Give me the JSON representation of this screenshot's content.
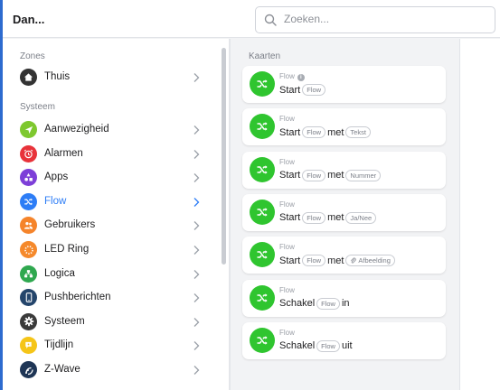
{
  "header": {
    "title": "Dan...",
    "search_placeholder": "Zoeken..."
  },
  "sidebar": {
    "zones_label": "Zones",
    "systeem_label": "Systeem",
    "zones": [
      {
        "label": "Thuis",
        "icon": "home-icon",
        "color": "#333333"
      }
    ],
    "items": [
      {
        "label": "Aanwezigheid",
        "icon": "location-arrow-icon",
        "color": "#7ec82f"
      },
      {
        "label": "Alarmen",
        "icon": "alarm-clock-icon",
        "color": "#e8333a"
      },
      {
        "label": "Apps",
        "icon": "apps-shapes-icon",
        "color": "#7d3fd8"
      },
      {
        "label": "Flow",
        "icon": "flow-shuffle-icon",
        "color": "#2d7df6",
        "active": true
      },
      {
        "label": "Gebruikers",
        "icon": "users-icon",
        "color": "#f5842b"
      },
      {
        "label": "LED Ring",
        "icon": "led-ring-icon",
        "color": "#f5892b"
      },
      {
        "label": "Logica",
        "icon": "logic-blocks-icon",
        "color": "#2fa84f"
      },
      {
        "label": "Pushberichten",
        "icon": "phone-icon",
        "color": "#24456b"
      },
      {
        "label": "Systeem",
        "icon": "gear-icon",
        "color": "#3a3a3a"
      },
      {
        "label": "Tijdlijn",
        "icon": "timeline-icon",
        "color": "#f5c518"
      },
      {
        "label": "Z-Wave",
        "icon": "zwave-icon",
        "color": "#1e3555"
      }
    ]
  },
  "main": {
    "kaarten_label": "Kaarten",
    "cards": [
      {
        "kind": "Flow",
        "has_info": true,
        "verb": "Start",
        "tag": "Flow",
        "extra_word": "",
        "extra_tag": "",
        "extra_icon": ""
      },
      {
        "kind": "Flow",
        "verb": "Start",
        "tag": "Flow",
        "extra_word": "met",
        "extra_tag": "Tekst",
        "extra_icon": ""
      },
      {
        "kind": "Flow",
        "verb": "Start",
        "tag": "Flow",
        "extra_word": "met",
        "extra_tag": "Nummer",
        "extra_icon": ""
      },
      {
        "kind": "Flow",
        "verb": "Start",
        "tag": "Flow",
        "extra_word": "met",
        "extra_tag": "Ja/Nee",
        "extra_icon": ""
      },
      {
        "kind": "Flow",
        "verb": "Start",
        "tag": "Flow",
        "extra_word": "met",
        "extra_tag": "Afbeelding",
        "extra_icon": "paperclip-icon"
      },
      {
        "kind": "Flow",
        "verb": "Schakel",
        "tag": "Flow",
        "extra_word": "in",
        "extra_tag": "",
        "extra_icon": ""
      },
      {
        "kind": "Flow",
        "verb": "Schakel",
        "tag": "Flow",
        "extra_word": "uit",
        "extra_tag": "",
        "extra_icon": ""
      }
    ]
  }
}
